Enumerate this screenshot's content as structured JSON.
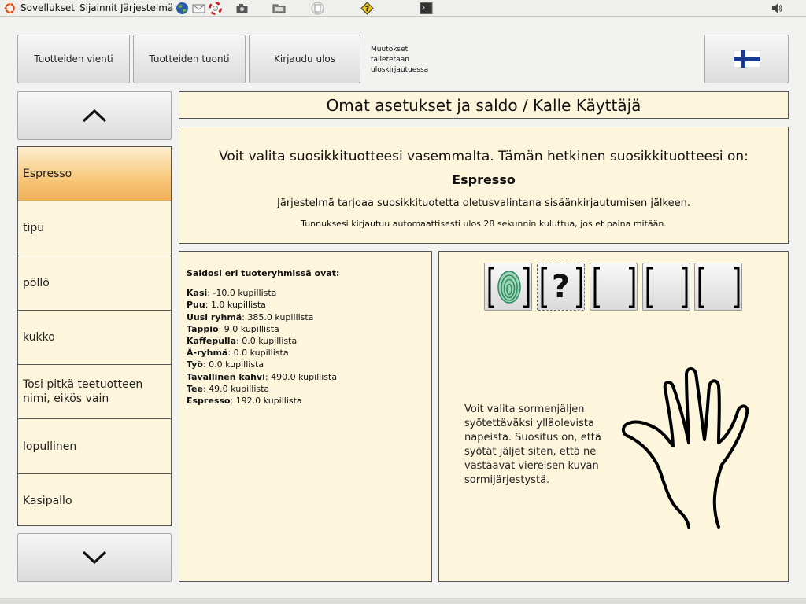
{
  "topbar": {
    "menus": [
      "Sovellukset",
      "Sijainnit",
      "Järjestelmä"
    ],
    "icons": [
      "ubuntu-logo-icon",
      "browser-globe-icon",
      "mail-icon",
      "help-lifebuoy-icon",
      "camera-icon",
      "file-manager-icon",
      "document-icon",
      "warning-help-icon",
      "terminal-icon",
      "volume-icon"
    ]
  },
  "toolbar": {
    "export_label": "Tuotteiden vienti",
    "import_label": "Tuotteiden tuonti",
    "logout_label": "Kirjaudu ulos",
    "note_lines": [
      "Muutokset",
      "talletetaan",
      "uloskirjautuessa"
    ],
    "language_flag": "finland-flag-icon"
  },
  "products": {
    "items": [
      {
        "label": "Espresso",
        "selected": true
      },
      {
        "label": "tipu"
      },
      {
        "label": "pöllö"
      },
      {
        "label": "kukko"
      },
      {
        "label": "Tosi pitkä teetuotteen nimi, eikös vain"
      },
      {
        "label": "lopullinen"
      },
      {
        "label": "Kasipallo"
      }
    ]
  },
  "page": {
    "title": "Omat asetukset ja saldo / Kalle Käyttäjä"
  },
  "info": {
    "line1": "Voit valita suosikkituotteesi vasemmalta. Tämän hetkinen suosikkituotteesi on:",
    "favorite": "Espresso",
    "line3": "Järjestelmä tarjoaa suosikkituotetta oletusvalintana sisäänkirjautumisen jälkeen.",
    "line4": "Tunnuksesi kirjautuu automaattisesti ulos 28 sekunnin kuluttua, jos et paina mitään."
  },
  "balance": {
    "heading": "Saldosi eri tuoteryhmissä ovat:",
    "rows": [
      {
        "group": "Kasi",
        "value": "-10.0 kupillista"
      },
      {
        "group": "Puu",
        "value": "1.0 kupillista"
      },
      {
        "group": "Uusi ryhmä",
        "value": "385.0 kupillista"
      },
      {
        "group": "Tappio",
        "value": "9.0 kupillista"
      },
      {
        "group": "Kaffepulla",
        "value": "0.0 kupillista"
      },
      {
        "group": "Ä-ryhmä",
        "value": "0.0 kupillista"
      },
      {
        "group": "Työ",
        "value": "0.0 kupillista"
      },
      {
        "group": "Tavallinen kahvi",
        "value": "490.0 kupillista"
      },
      {
        "group": "Tee",
        "value": "49.0 kupillista"
      },
      {
        "group": "Espresso",
        "value": "192.0 kupillista"
      }
    ]
  },
  "fingerprint": {
    "slots": [
      {
        "state": "recorded"
      },
      {
        "state": "active",
        "symbol": "?"
      },
      {
        "state": "empty"
      },
      {
        "state": "empty"
      },
      {
        "state": "empty"
      }
    ],
    "instructions": "Voit valita sormenjäljen syötettäväksi ylläolevista napeista. Suositus on, että syötät jäljet siten, että ne vastaavat viereisen kuvan sormijärjestystä.",
    "colors": {
      "fingerprint": "#2e8b62"
    }
  }
}
